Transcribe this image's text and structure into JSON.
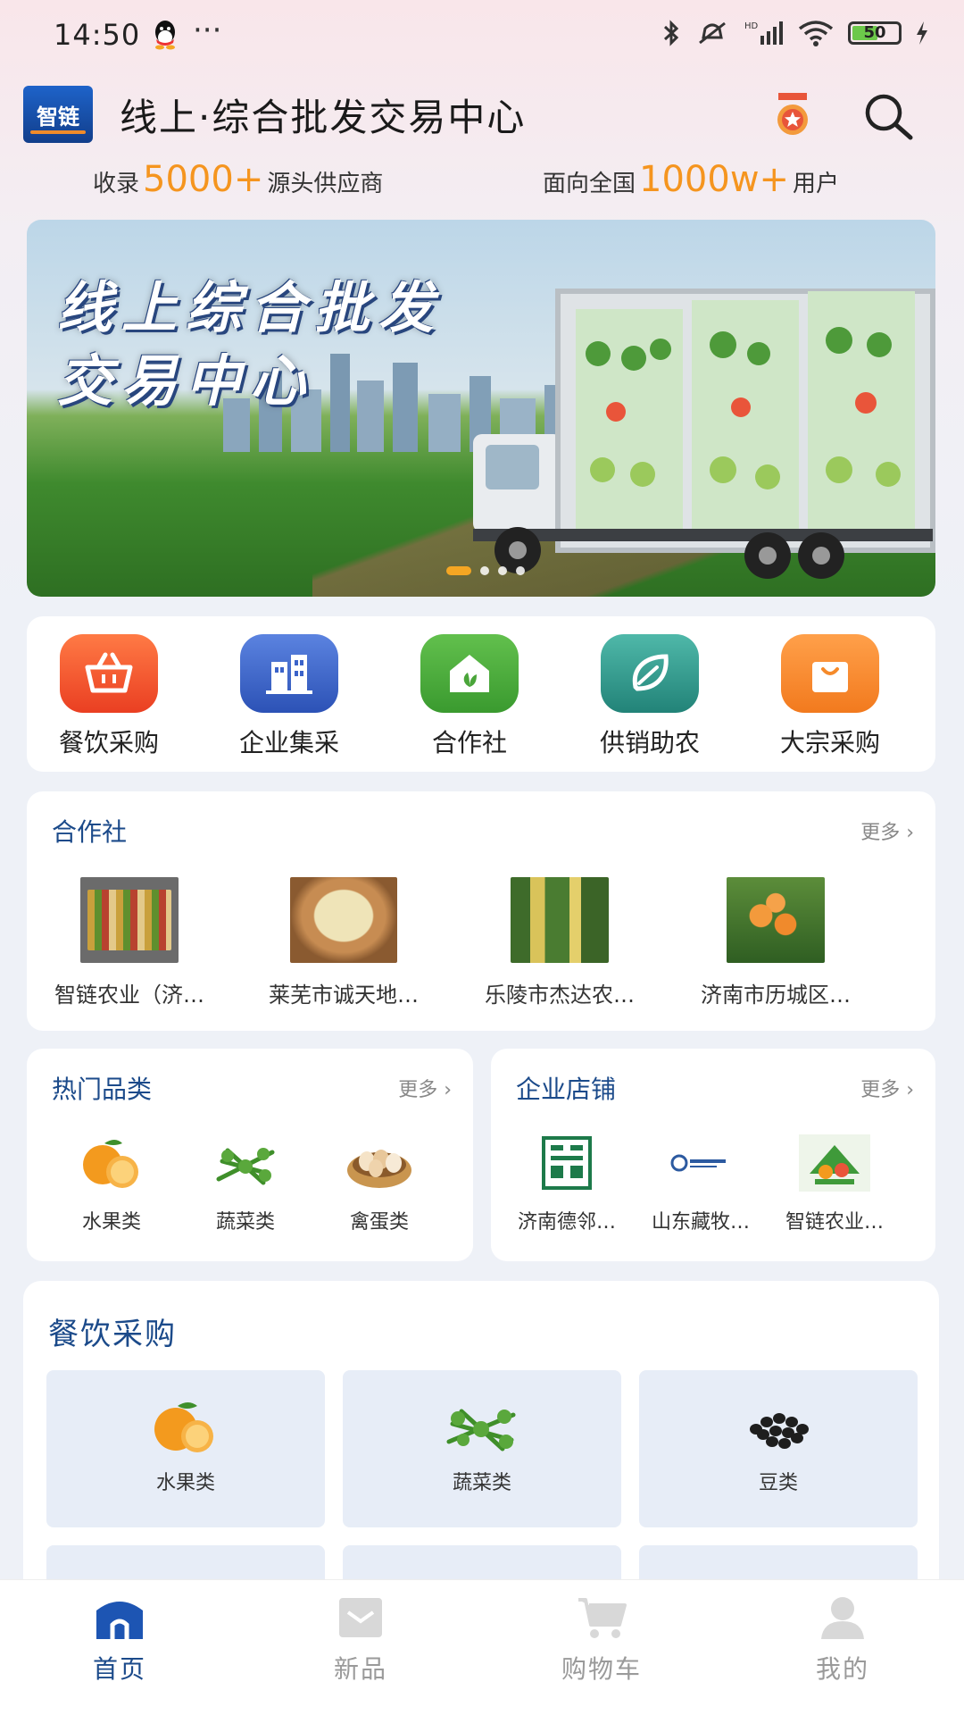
{
  "status_bar": {
    "time": "14:50",
    "more": "···",
    "battery": "50"
  },
  "header": {
    "logo_text": "智链",
    "title": "线上·综合批发交易中心",
    "stats": [
      {
        "prefix": "收录",
        "value": "5000+",
        "suffix": "源头供应商"
      },
      {
        "prefix": "面向全国",
        "value": "1000w+",
        "suffix": "用户"
      }
    ]
  },
  "banner": {
    "line1": "线上综合批发",
    "line2": "交易中心",
    "slide_count": 4,
    "active_slide": 1
  },
  "quick_nav": [
    {
      "label": "餐饮采购",
      "icon": "basket-icon",
      "color": "#f0522f"
    },
    {
      "label": "企业集采",
      "icon": "building-icon",
      "color": "#3b63c9"
    },
    {
      "label": "合作社",
      "icon": "house-leaf-icon",
      "color": "#4aa53a"
    },
    {
      "label": "供销助农",
      "icon": "leaf-icon",
      "color": "#2e9a8f"
    },
    {
      "label": "大宗采购",
      "icon": "shopping-bag-icon",
      "color": "#f58a2a"
    }
  ],
  "cooperative": {
    "title": "合作社",
    "more": "更多",
    "items": [
      {
        "name": "智链农业（济…"
      },
      {
        "name": "莱芜市诚天地…"
      },
      {
        "name": "乐陵市杰达农…"
      },
      {
        "name": "济南市历城区…"
      }
    ]
  },
  "hot_categories": {
    "title": "热门品类",
    "more": "更多",
    "items": [
      {
        "name": "水果类"
      },
      {
        "name": "蔬菜类"
      },
      {
        "name": "禽蛋类"
      }
    ]
  },
  "enterprise_shops": {
    "title": "企业店铺",
    "more": "更多",
    "items": [
      {
        "name": "济南德邻…"
      },
      {
        "name": "山东藏牧…"
      },
      {
        "name": "智链农业…"
      }
    ]
  },
  "catering": {
    "title": "餐饮采购",
    "items": [
      {
        "name": "水果类"
      },
      {
        "name": "蔬菜类"
      },
      {
        "name": "豆类"
      }
    ]
  },
  "tab_bar": [
    {
      "label": "首页",
      "active": true
    },
    {
      "label": "新品",
      "active": false
    },
    {
      "label": "购物车",
      "active": false
    },
    {
      "label": "我的",
      "active": false
    }
  ],
  "colors": {
    "accent": "#1b4a8a",
    "highlight": "#f5951f",
    "bg": "#eef1f7"
  }
}
